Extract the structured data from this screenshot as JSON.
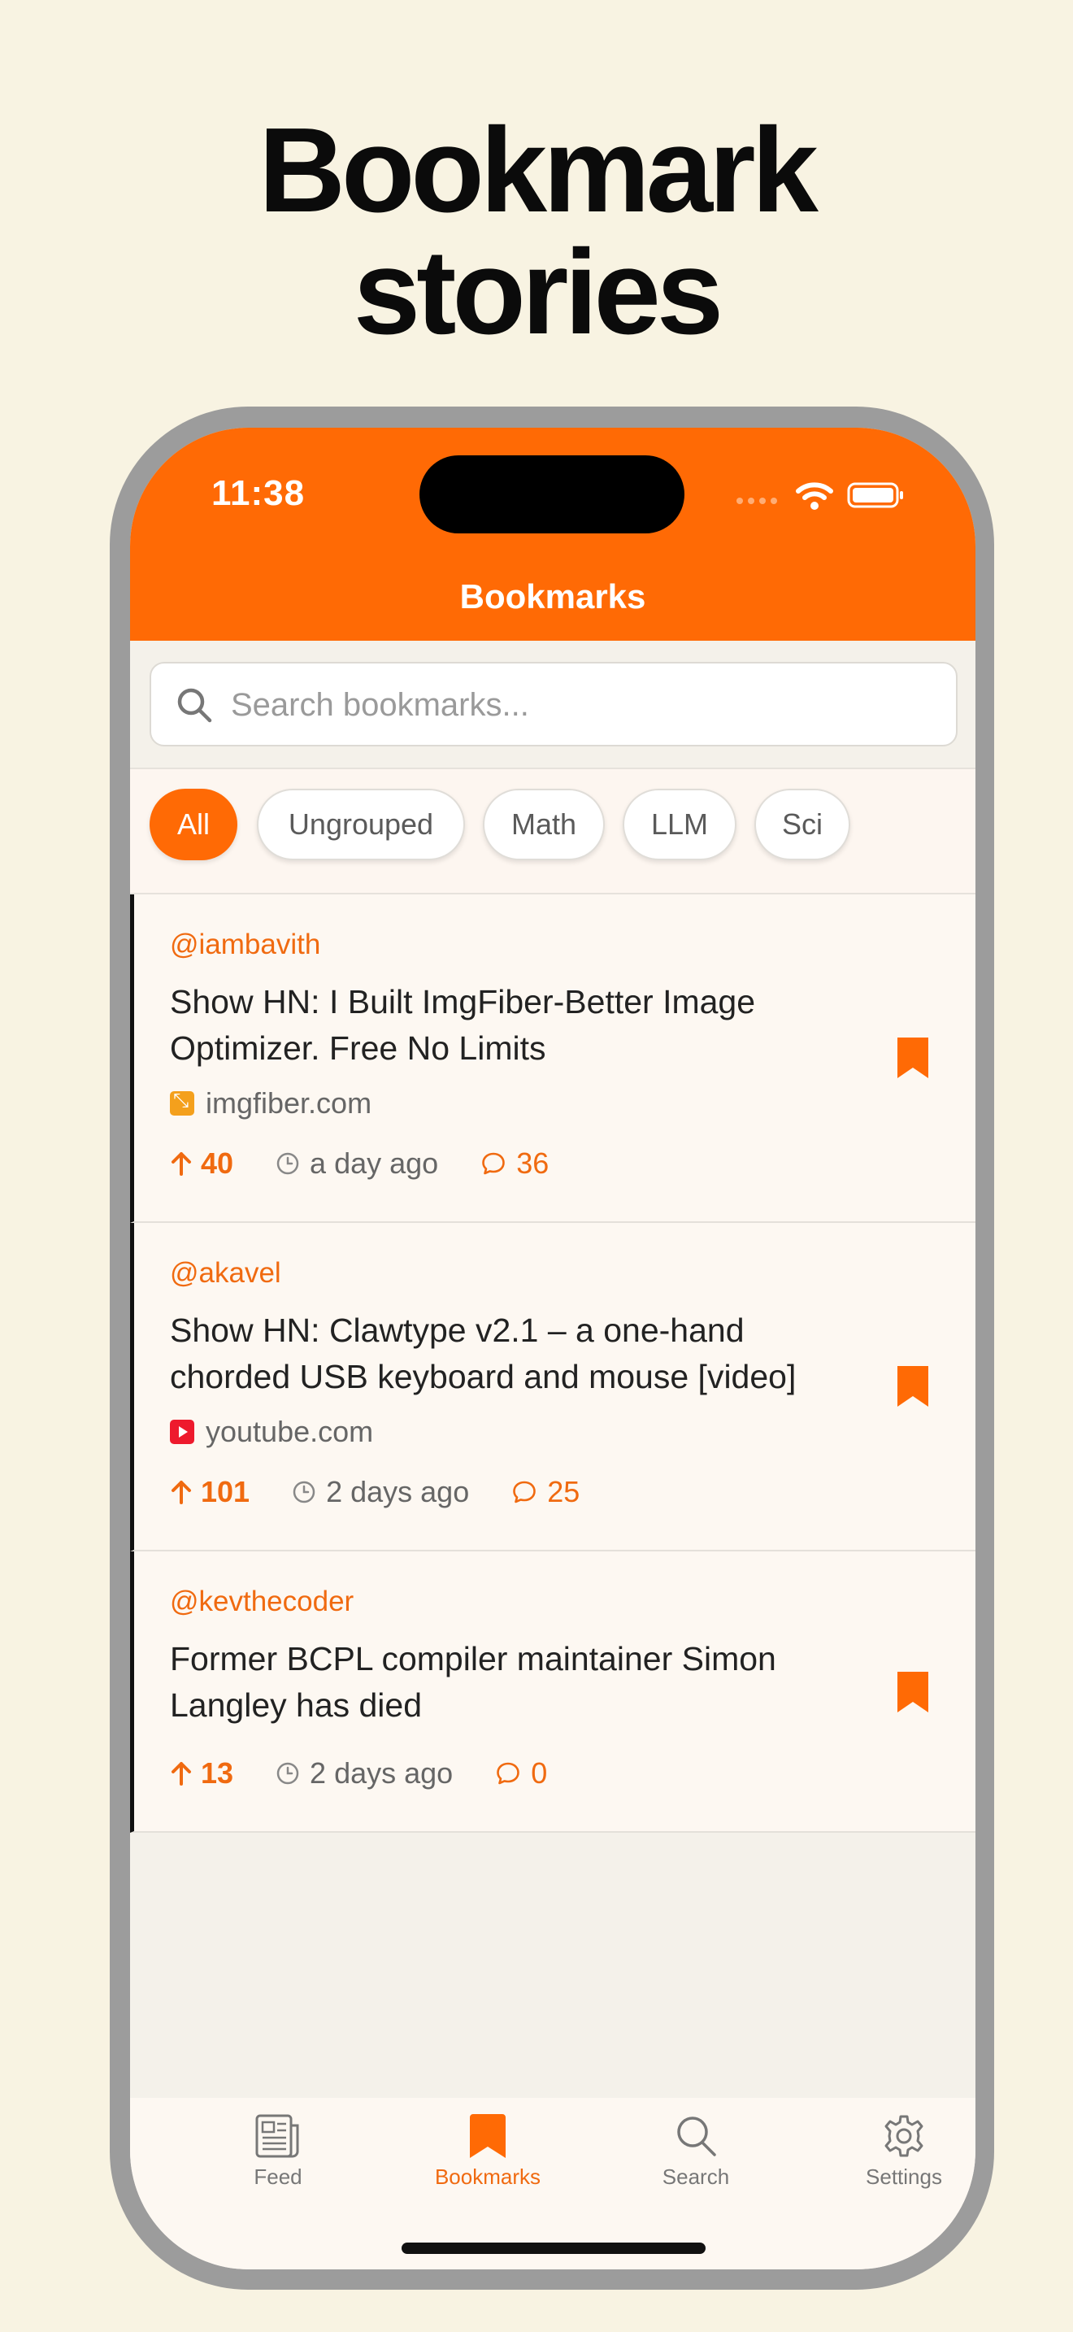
{
  "headline": [
    "Bookmark",
    "stories"
  ],
  "status_bar": {
    "time": "11:38"
  },
  "nav": {
    "title": "Bookmarks"
  },
  "search": {
    "placeholder": "Search bookmarks..."
  },
  "chips": [
    {
      "label": "All",
      "active": true
    },
    {
      "label": "Ungrouped",
      "active": false
    },
    {
      "label": "Math",
      "active": false
    },
    {
      "label": "LLM",
      "active": false
    },
    {
      "label": "Sci",
      "active": false
    }
  ],
  "stories": [
    {
      "author": "@iambavith",
      "title": "Show HN: I Built ImgFiber-Better Image Optimizer. Free No Limits",
      "domain": "imgfiber.com",
      "points": "40",
      "ago": "a day ago",
      "comments": "36"
    },
    {
      "author": "@akavel",
      "title": "Show HN: Clawtype v2.1 – a one-hand chorded USB keyboard and mouse [video]",
      "domain": "youtube.com",
      "points": "101",
      "ago": "2 days ago",
      "comments": "25"
    },
    {
      "author": "@kevthecoder",
      "title": "Former BCPL compiler maintainer Simon Langley has died",
      "domain": "",
      "points": "13",
      "ago": "2 days ago",
      "comments": "0"
    }
  ],
  "tabs": [
    {
      "label": "Feed",
      "icon": "newspaper-icon",
      "active": false
    },
    {
      "label": "Bookmarks",
      "icon": "bookmark-icon",
      "active": true
    },
    {
      "label": "Search",
      "icon": "search-icon",
      "active": false
    },
    {
      "label": "Settings",
      "icon": "gear-icon",
      "active": false
    }
  ],
  "colors": {
    "accent": "#ff6a05",
    "background": "#f8f3e2",
    "frame": "#9c9c9c"
  }
}
